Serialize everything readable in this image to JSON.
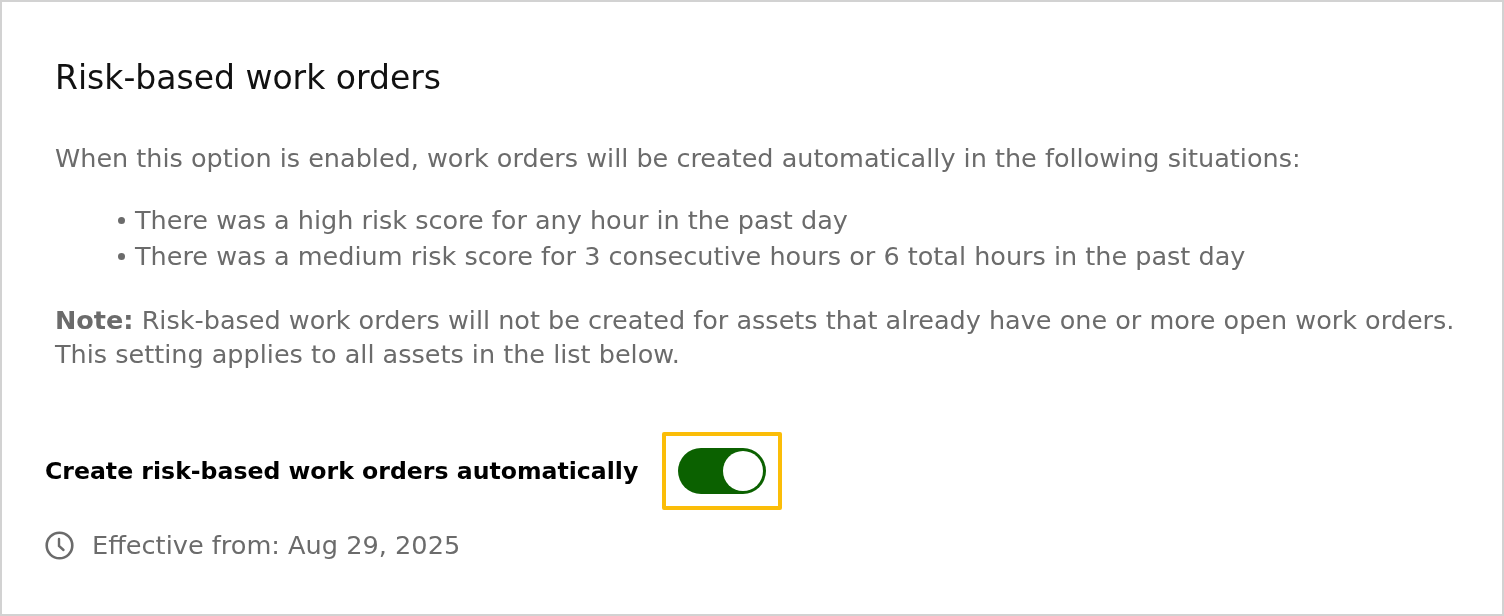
{
  "section": {
    "title": "Risk-based work orders",
    "intro": "When this option is enabled, work orders will be created automatically in the following situations:",
    "conditions": [
      "There was a high risk score for any hour in the past day",
      "There was a medium risk score for 3 consecutive hours or 6 total hours in the past day"
    ],
    "note": "**Note:** Risk-based work orders will not be created for assets that already have one or more open work orders. This setting applies to all assets in the list below."
  },
  "setting": {
    "label": "Create risk-based work orders automatically",
    "on": true,
    "highlighted": true
  },
  "effective": {
    "text": "Effective from: Aug 29, 2025"
  }
}
